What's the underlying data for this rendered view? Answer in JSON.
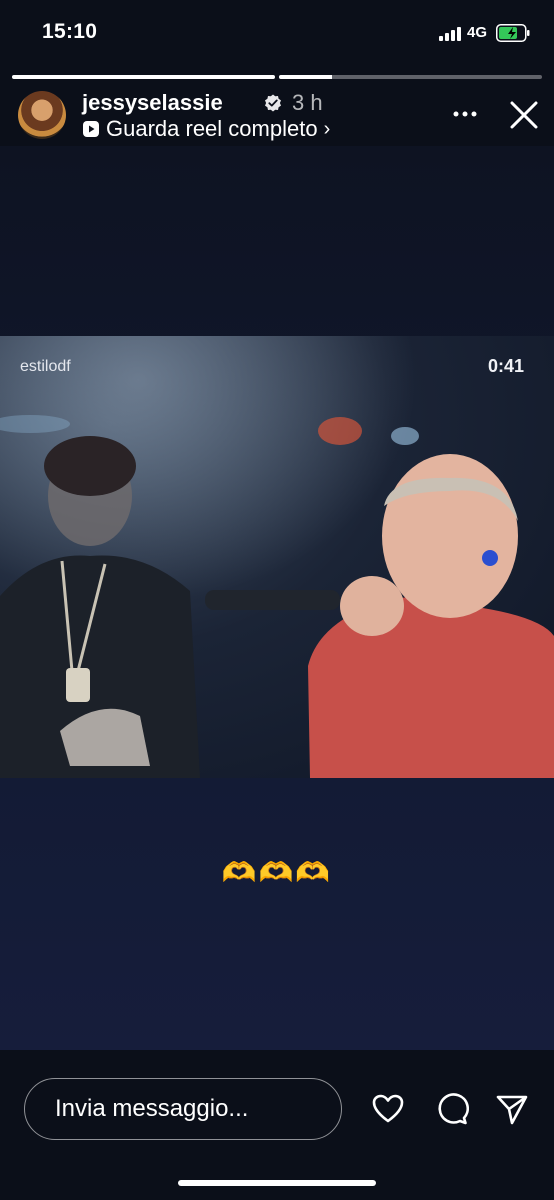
{
  "status_bar": {
    "time": "15:10",
    "network": "4G",
    "battery_level": 0.75
  },
  "story": {
    "progress": [
      1.0,
      0.2
    ],
    "username": "jessyselassie",
    "time_ago": "3 h",
    "reel_link": "Guarda reel completo",
    "reel_link_arrow": "›"
  },
  "reel": {
    "account": "estilodf",
    "duration": "0:41"
  },
  "caption": "🫶🫶🫶",
  "composer": {
    "placeholder": "Invia messaggio..."
  },
  "icons": {
    "like": "heart-icon",
    "comment": "comment-icon",
    "share": "send-icon",
    "more": "more-icon",
    "close": "close-icon"
  },
  "colors": {
    "background": "#0b0f19",
    "accent": "#d98a3d"
  }
}
